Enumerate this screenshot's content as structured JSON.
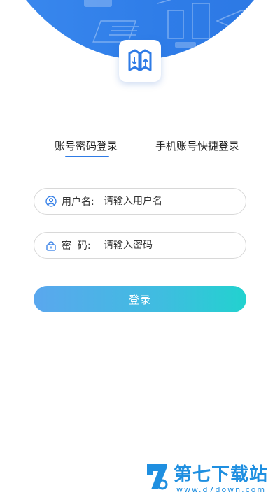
{
  "tabs": [
    {
      "label": "账号密码登录",
      "active": true
    },
    {
      "label": "手机账号快捷登录",
      "active": false
    }
  ],
  "form": {
    "username": {
      "label": "用户名:",
      "placeholder": "请输入用户名",
      "value": "",
      "icon": "user-icon"
    },
    "password": {
      "label": "密  码:",
      "placeholder": "请输入密码",
      "value": "",
      "icon": "lock-icon"
    }
  },
  "login_button": {
    "label": "登录"
  },
  "watermark": {
    "title": "第七下载站",
    "url": "www.d7down.com"
  },
  "colors": {
    "primary": "#2e7be6",
    "button_start": "#5aa7ee",
    "button_end": "#22d2cf",
    "watermark": "#1f8fe0"
  }
}
